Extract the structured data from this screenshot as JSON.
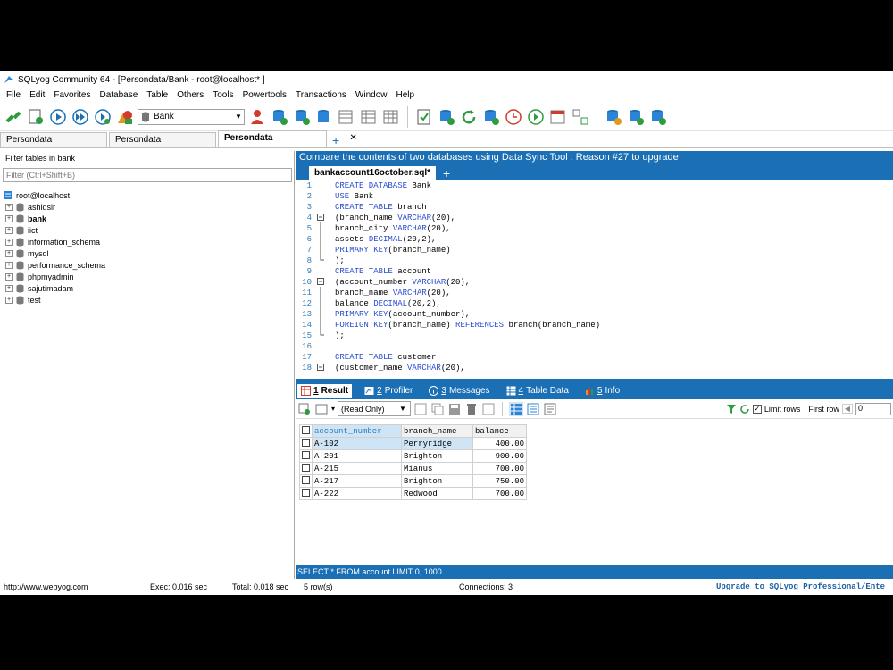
{
  "window": {
    "title": "SQLyog Community 64 - [Persondata/Bank - root@localhost* ]"
  },
  "menu": [
    "File",
    "Edit",
    "Favorites",
    "Database",
    "Table",
    "Others",
    "Tools",
    "Powertools",
    "Transactions",
    "Window",
    "Help"
  ],
  "toolbar": {
    "database_select": "Bank"
  },
  "conn_tabs": [
    {
      "label": "Persondata"
    },
    {
      "label": "Persondata"
    },
    {
      "label": "Persondata",
      "close": "✕"
    }
  ],
  "conn_add": "+",
  "object_browser": {
    "header": "Filter tables in bank",
    "filter_placeholder": "Filter (Ctrl+Shift+B)",
    "root": "root@localhost",
    "databases": [
      "ashiqsir",
      "bank",
      "iict",
      "information_schema",
      "mysql",
      "performance_schema",
      "phpmyadmin",
      "sajutimadam",
      "test"
    ]
  },
  "promo": "Compare the contents of two databases using Data Sync Tool : Reason #27 to upgrade",
  "query_tab": {
    "label": "bankaccount16october.sql*",
    "add": "+"
  },
  "editor_lines": [
    {
      "n": "1",
      "fold": "",
      "parts": [
        [
          "kw",
          "CREATE DATABASE "
        ],
        [
          "c",
          "Bank"
        ]
      ]
    },
    {
      "n": "2",
      "fold": "",
      "parts": [
        [
          "kw",
          "USE "
        ],
        [
          "c",
          "Bank"
        ]
      ]
    },
    {
      "n": "3",
      "fold": "",
      "parts": [
        [
          "kw",
          "CREATE TABLE "
        ],
        [
          "c",
          "branch"
        ]
      ]
    },
    {
      "n": "4",
      "fold": "open",
      "parts": [
        [
          "c",
          "(branch_name "
        ],
        [
          "kw",
          "VARCHAR"
        ],
        [
          "c",
          "(20),"
        ]
      ]
    },
    {
      "n": "5",
      "fold": "mid",
      "parts": [
        [
          "c",
          "branch_city "
        ],
        [
          "kw",
          "VARCHAR"
        ],
        [
          "c",
          "(20),"
        ]
      ]
    },
    {
      "n": "6",
      "fold": "mid",
      "parts": [
        [
          "c",
          "assets "
        ],
        [
          "kw",
          "DECIMAL"
        ],
        [
          "c",
          "(20,2),"
        ]
      ]
    },
    {
      "n": "7",
      "fold": "mid",
      "parts": [
        [
          "kw",
          "PRIMARY KEY"
        ],
        [
          "c",
          "(branch_name)"
        ]
      ]
    },
    {
      "n": "8",
      "fold": "end",
      "parts": [
        [
          "c",
          ");"
        ]
      ]
    },
    {
      "n": "9",
      "fold": "",
      "parts": [
        [
          "kw",
          "CREATE TABLE "
        ],
        [
          "c",
          "account"
        ]
      ]
    },
    {
      "n": "10",
      "fold": "open",
      "parts": [
        [
          "c",
          "(account_number "
        ],
        [
          "kw",
          "VARCHAR"
        ],
        [
          "c",
          "(20),"
        ]
      ]
    },
    {
      "n": "11",
      "fold": "mid",
      "parts": [
        [
          "c",
          "branch_name "
        ],
        [
          "kw",
          "VARCHAR"
        ],
        [
          "c",
          "(20),"
        ]
      ]
    },
    {
      "n": "12",
      "fold": "mid",
      "parts": [
        [
          "c",
          "balance "
        ],
        [
          "kw",
          "DECIMAL"
        ],
        [
          "c",
          "(20,2),"
        ]
      ]
    },
    {
      "n": "13",
      "fold": "mid",
      "parts": [
        [
          "kw",
          "PRIMARY KEY"
        ],
        [
          "c",
          "(account_number),"
        ]
      ]
    },
    {
      "n": "14",
      "fold": "mid",
      "parts": [
        [
          "kw",
          "FOREIGN KEY"
        ],
        [
          "c",
          "(branch_name) "
        ],
        [
          "kw",
          "REFERENCES "
        ],
        [
          "c",
          "branch(branch_name)"
        ]
      ]
    },
    {
      "n": "15",
      "fold": "end",
      "parts": [
        [
          "c",
          ");"
        ]
      ]
    },
    {
      "n": "16",
      "fold": "",
      "parts": []
    },
    {
      "n": "17",
      "fold": "",
      "parts": [
        [
          "kw",
          "CREATE TABLE "
        ],
        [
          "c",
          "customer"
        ]
      ]
    },
    {
      "n": "18",
      "fold": "open",
      "parts": [
        [
          "c",
          "(customer_name "
        ],
        [
          "kw",
          "VARCHAR"
        ],
        [
          "c",
          "(20),"
        ]
      ]
    }
  ],
  "result_tabs": [
    {
      "num": "1",
      "label": "Result"
    },
    {
      "num": "2",
      "label": "Profiler"
    },
    {
      "num": "3",
      "label": "Messages"
    },
    {
      "num": "4",
      "label": "Table Data"
    },
    {
      "num": "5",
      "label": "Info"
    }
  ],
  "result_toolbar": {
    "mode": "(Read Only)",
    "limit_label": "Limit rows",
    "first_row_label": "First row",
    "first_row_value": "0",
    "limit_checked": "✓"
  },
  "result_grid": {
    "columns": [
      "account_number",
      "branch_name",
      "balance"
    ],
    "rows": [
      [
        "A-102",
        "Perryridge",
        "400.00"
      ],
      [
        "A-201",
        "Brighton",
        "900.00"
      ],
      [
        "A-215",
        "Mianus",
        "700.00"
      ],
      [
        "A-217",
        "Brighton",
        "750.00"
      ],
      [
        "A-222",
        "Redwood",
        "700.00"
      ]
    ]
  },
  "sql_status": "SELECT * FROM account LIMIT 0, 1000",
  "statusbar": {
    "url": "http://www.webyog.com",
    "exec": "Exec: 0.016 sec",
    "total": "Total: 0.018 sec",
    "rows": "5 row(s)",
    "connections": "Connections: 3",
    "upgrade": "Upgrade to SQLyog Professional/Ente"
  },
  "colors": {
    "accent": "#1a6fb5",
    "keyword": "#2a4ccf",
    "line_number": "#2a7ab8"
  }
}
